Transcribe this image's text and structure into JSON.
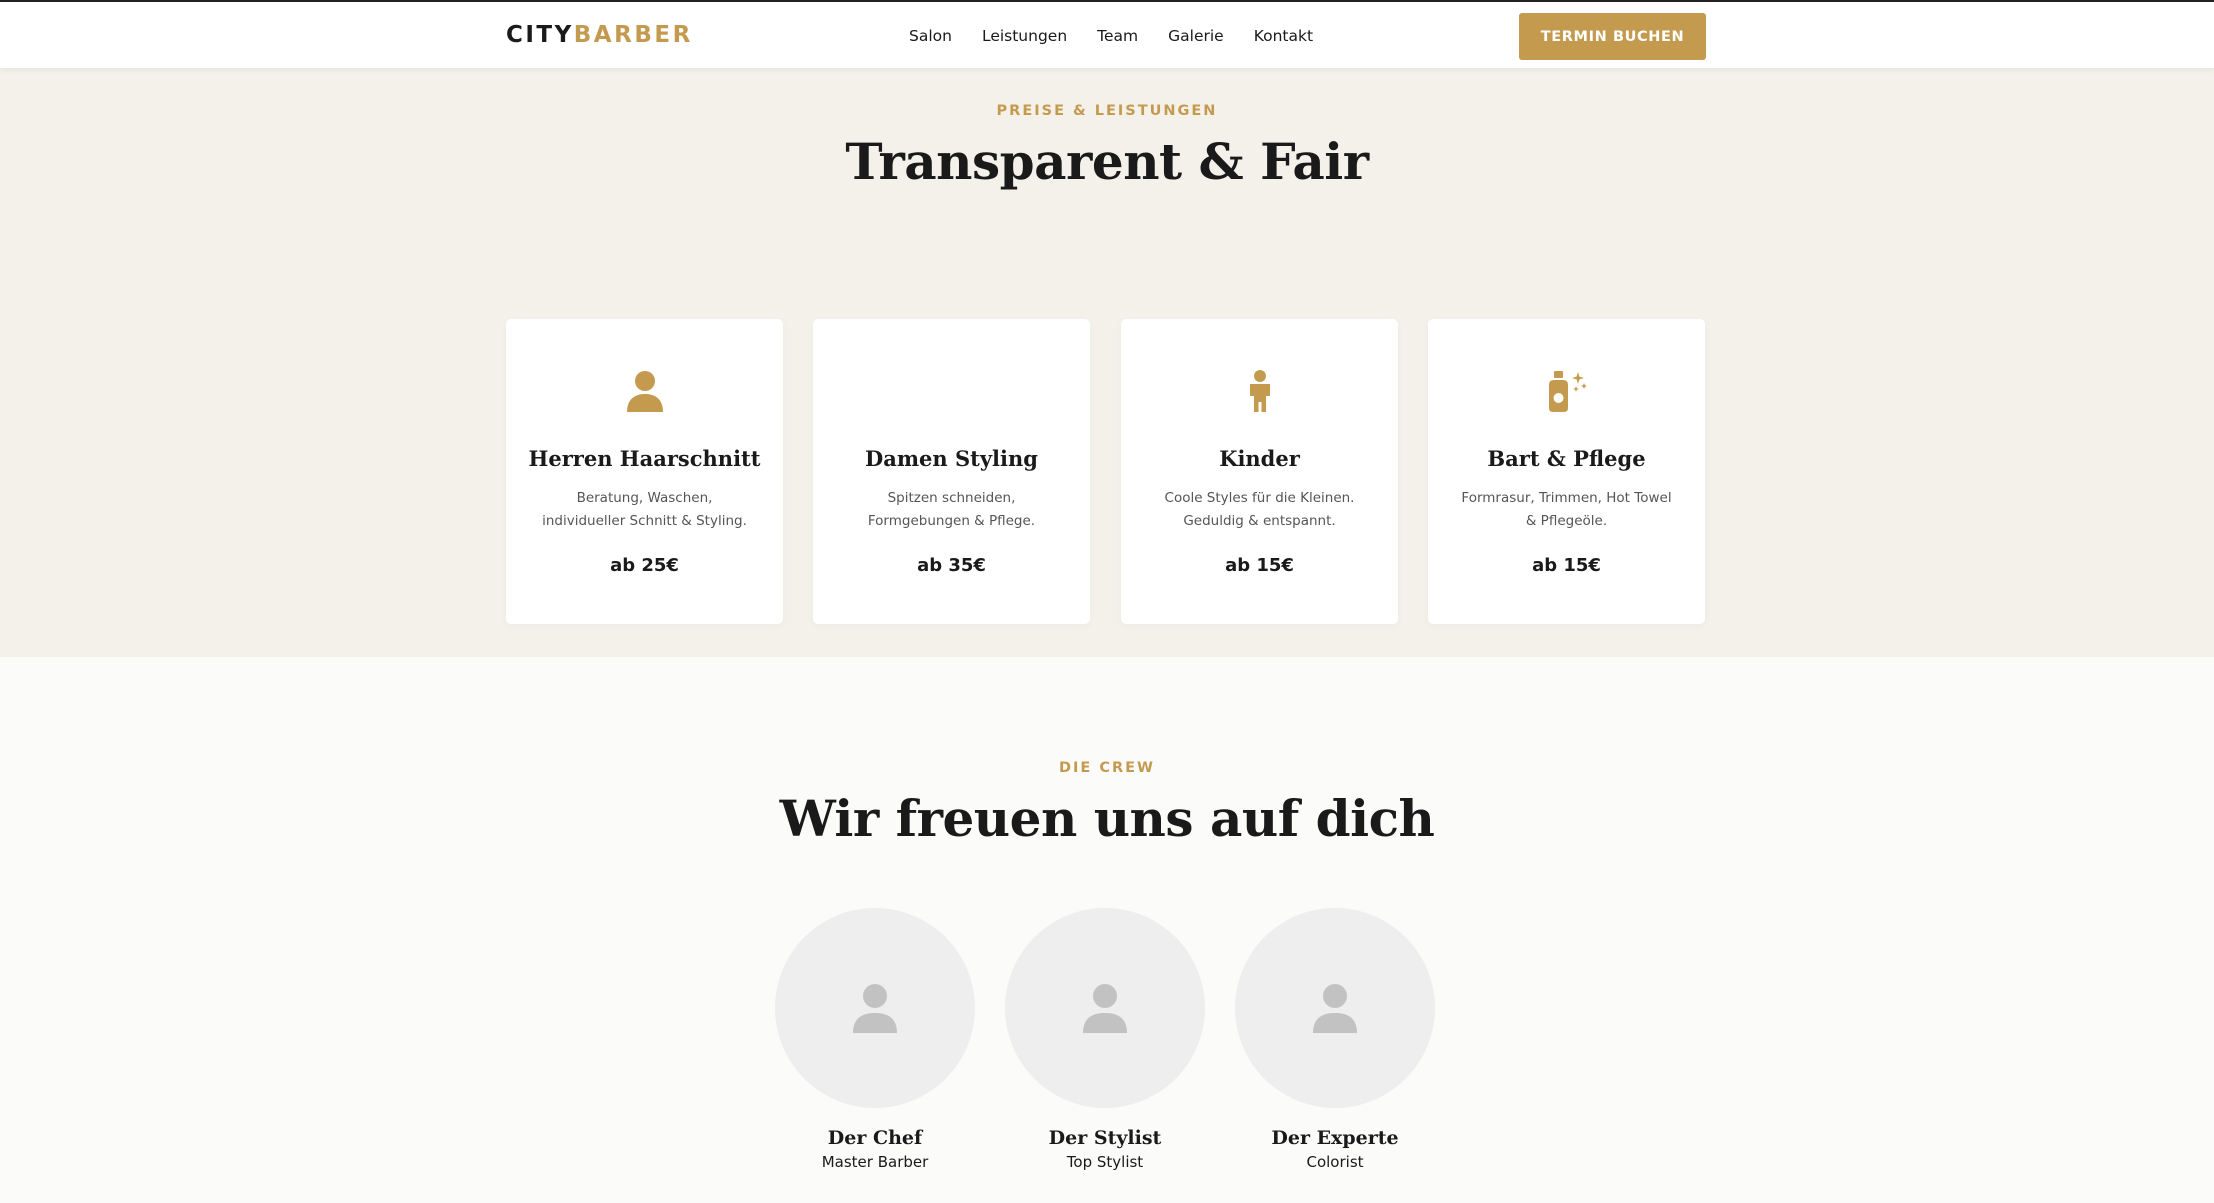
{
  "header": {
    "logo_part1": "CITY",
    "logo_part2": "BARBER",
    "nav": [
      "Salon",
      "Leistungen",
      "Team",
      "Galerie",
      "Kontakt"
    ],
    "cta_label": "TERMIN BUCHEN"
  },
  "pricing": {
    "eyebrow": "PREISE & LEISTUNGEN",
    "title": "Transparent & Fair",
    "cards": [
      {
        "icon": "user-icon",
        "title": "Herren Haarschnitt",
        "desc": "Beratung, Waschen, individueller Schnitt & Styling.",
        "price": "ab 25€"
      },
      {
        "icon": "",
        "title": "Damen Styling",
        "desc": "Spitzen schneiden, Formgebungen & Pflege.",
        "price": "ab 35€"
      },
      {
        "icon": "child-icon",
        "title": "Kinder",
        "desc": "Coole Styles für die Kleinen. Geduldig & entspannt.",
        "price": "ab 15€"
      },
      {
        "icon": "spray-bottle-icon",
        "title": "Bart & Pflege",
        "desc": "Formrasur, Trimmen, Hot Towel & Pflegeöle.",
        "price": "ab 15€"
      }
    ]
  },
  "team": {
    "eyebrow": "DIE CREW",
    "title": "Wir freuen uns auf dich",
    "members": [
      {
        "icon": "avatar-placeholder-icon",
        "name": "Der Chef",
        "role": "Master Barber"
      },
      {
        "icon": "avatar-placeholder-icon",
        "name": "Der Stylist",
        "role": "Top Stylist"
      },
      {
        "icon": "avatar-placeholder-icon",
        "name": "Der Experte",
        "role": "Colorist"
      }
    ]
  },
  "colors": {
    "accent": "#c49a4f",
    "section_bg": "#f4f1eb",
    "text": "#1a1a1a",
    "avatar_bg": "#eeeeee",
    "avatar_icon": "#c2c2c2"
  }
}
